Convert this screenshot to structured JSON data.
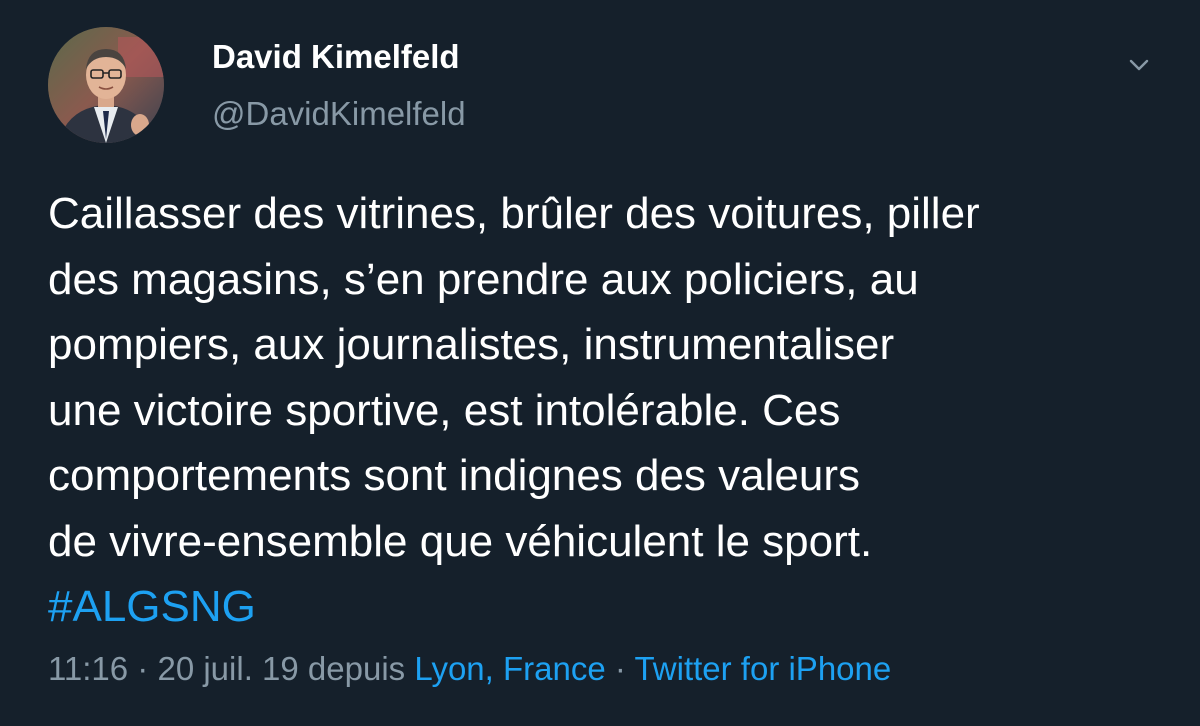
{
  "author": {
    "display_name": "David Kimelfeld",
    "handle": "@DavidKimelfeld"
  },
  "tweet": {
    "lines": [
      "Caillasser des vitrines, brûler des voitures, piller",
      "des magasins, s’en prendre aux policiers, au",
      "pompiers, aux journalistes, instrumentaliser",
      "une victoire sportive, est intolérable. Ces",
      "comportements sont indignes des valeurs",
      "de vivre-ensemble que véhiculent le sport."
    ],
    "hashtag": "#ALGSNG"
  },
  "meta": {
    "time": "11:16",
    "separator1": " · ",
    "date": "20 juil. 19",
    "depuis": " depuis ",
    "location": "Lyon, France",
    "separator2": " · ",
    "source": "Twitter for iPhone"
  },
  "colors": {
    "background": "#15202b",
    "text": "#ffffff",
    "secondary": "#8899a6",
    "accent": "#1da1f2"
  },
  "icons": {
    "caret": "chevron-down-icon",
    "avatar": "profile-photo"
  }
}
